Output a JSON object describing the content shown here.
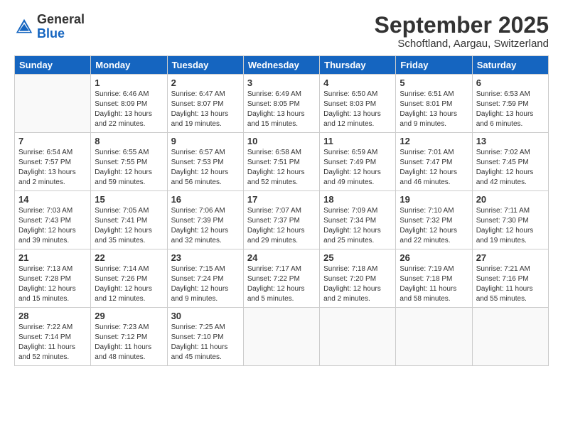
{
  "logo": {
    "general": "General",
    "blue": "Blue"
  },
  "title": "September 2025",
  "location": "Schoftland, Aargau, Switzerland",
  "headers": [
    "Sunday",
    "Monday",
    "Tuesday",
    "Wednesday",
    "Thursday",
    "Friday",
    "Saturday"
  ],
  "weeks": [
    [
      {
        "num": "",
        "info": ""
      },
      {
        "num": "1",
        "info": "Sunrise: 6:46 AM\nSunset: 8:09 PM\nDaylight: 13 hours\nand 22 minutes."
      },
      {
        "num": "2",
        "info": "Sunrise: 6:47 AM\nSunset: 8:07 PM\nDaylight: 13 hours\nand 19 minutes."
      },
      {
        "num": "3",
        "info": "Sunrise: 6:49 AM\nSunset: 8:05 PM\nDaylight: 13 hours\nand 15 minutes."
      },
      {
        "num": "4",
        "info": "Sunrise: 6:50 AM\nSunset: 8:03 PM\nDaylight: 13 hours\nand 12 minutes."
      },
      {
        "num": "5",
        "info": "Sunrise: 6:51 AM\nSunset: 8:01 PM\nDaylight: 13 hours\nand 9 minutes."
      },
      {
        "num": "6",
        "info": "Sunrise: 6:53 AM\nSunset: 7:59 PM\nDaylight: 13 hours\nand 6 minutes."
      }
    ],
    [
      {
        "num": "7",
        "info": "Sunrise: 6:54 AM\nSunset: 7:57 PM\nDaylight: 13 hours\nand 2 minutes."
      },
      {
        "num": "8",
        "info": "Sunrise: 6:55 AM\nSunset: 7:55 PM\nDaylight: 12 hours\nand 59 minutes."
      },
      {
        "num": "9",
        "info": "Sunrise: 6:57 AM\nSunset: 7:53 PM\nDaylight: 12 hours\nand 56 minutes."
      },
      {
        "num": "10",
        "info": "Sunrise: 6:58 AM\nSunset: 7:51 PM\nDaylight: 12 hours\nand 52 minutes."
      },
      {
        "num": "11",
        "info": "Sunrise: 6:59 AM\nSunset: 7:49 PM\nDaylight: 12 hours\nand 49 minutes."
      },
      {
        "num": "12",
        "info": "Sunrise: 7:01 AM\nSunset: 7:47 PM\nDaylight: 12 hours\nand 46 minutes."
      },
      {
        "num": "13",
        "info": "Sunrise: 7:02 AM\nSunset: 7:45 PM\nDaylight: 12 hours\nand 42 minutes."
      }
    ],
    [
      {
        "num": "14",
        "info": "Sunrise: 7:03 AM\nSunset: 7:43 PM\nDaylight: 12 hours\nand 39 minutes."
      },
      {
        "num": "15",
        "info": "Sunrise: 7:05 AM\nSunset: 7:41 PM\nDaylight: 12 hours\nand 35 minutes."
      },
      {
        "num": "16",
        "info": "Sunrise: 7:06 AM\nSunset: 7:39 PM\nDaylight: 12 hours\nand 32 minutes."
      },
      {
        "num": "17",
        "info": "Sunrise: 7:07 AM\nSunset: 7:37 PM\nDaylight: 12 hours\nand 29 minutes."
      },
      {
        "num": "18",
        "info": "Sunrise: 7:09 AM\nSunset: 7:34 PM\nDaylight: 12 hours\nand 25 minutes."
      },
      {
        "num": "19",
        "info": "Sunrise: 7:10 AM\nSunset: 7:32 PM\nDaylight: 12 hours\nand 22 minutes."
      },
      {
        "num": "20",
        "info": "Sunrise: 7:11 AM\nSunset: 7:30 PM\nDaylight: 12 hours\nand 19 minutes."
      }
    ],
    [
      {
        "num": "21",
        "info": "Sunrise: 7:13 AM\nSunset: 7:28 PM\nDaylight: 12 hours\nand 15 minutes."
      },
      {
        "num": "22",
        "info": "Sunrise: 7:14 AM\nSunset: 7:26 PM\nDaylight: 12 hours\nand 12 minutes."
      },
      {
        "num": "23",
        "info": "Sunrise: 7:15 AM\nSunset: 7:24 PM\nDaylight: 12 hours\nand 9 minutes."
      },
      {
        "num": "24",
        "info": "Sunrise: 7:17 AM\nSunset: 7:22 PM\nDaylight: 12 hours\nand 5 minutes."
      },
      {
        "num": "25",
        "info": "Sunrise: 7:18 AM\nSunset: 7:20 PM\nDaylight: 12 hours\nand 2 minutes."
      },
      {
        "num": "26",
        "info": "Sunrise: 7:19 AM\nSunset: 7:18 PM\nDaylight: 11 hours\nand 58 minutes."
      },
      {
        "num": "27",
        "info": "Sunrise: 7:21 AM\nSunset: 7:16 PM\nDaylight: 11 hours\nand 55 minutes."
      }
    ],
    [
      {
        "num": "28",
        "info": "Sunrise: 7:22 AM\nSunset: 7:14 PM\nDaylight: 11 hours\nand 52 minutes."
      },
      {
        "num": "29",
        "info": "Sunrise: 7:23 AM\nSunset: 7:12 PM\nDaylight: 11 hours\nand 48 minutes."
      },
      {
        "num": "30",
        "info": "Sunrise: 7:25 AM\nSunset: 7:10 PM\nDaylight: 11 hours\nand 45 minutes."
      },
      {
        "num": "",
        "info": ""
      },
      {
        "num": "",
        "info": ""
      },
      {
        "num": "",
        "info": ""
      },
      {
        "num": "",
        "info": ""
      }
    ]
  ]
}
